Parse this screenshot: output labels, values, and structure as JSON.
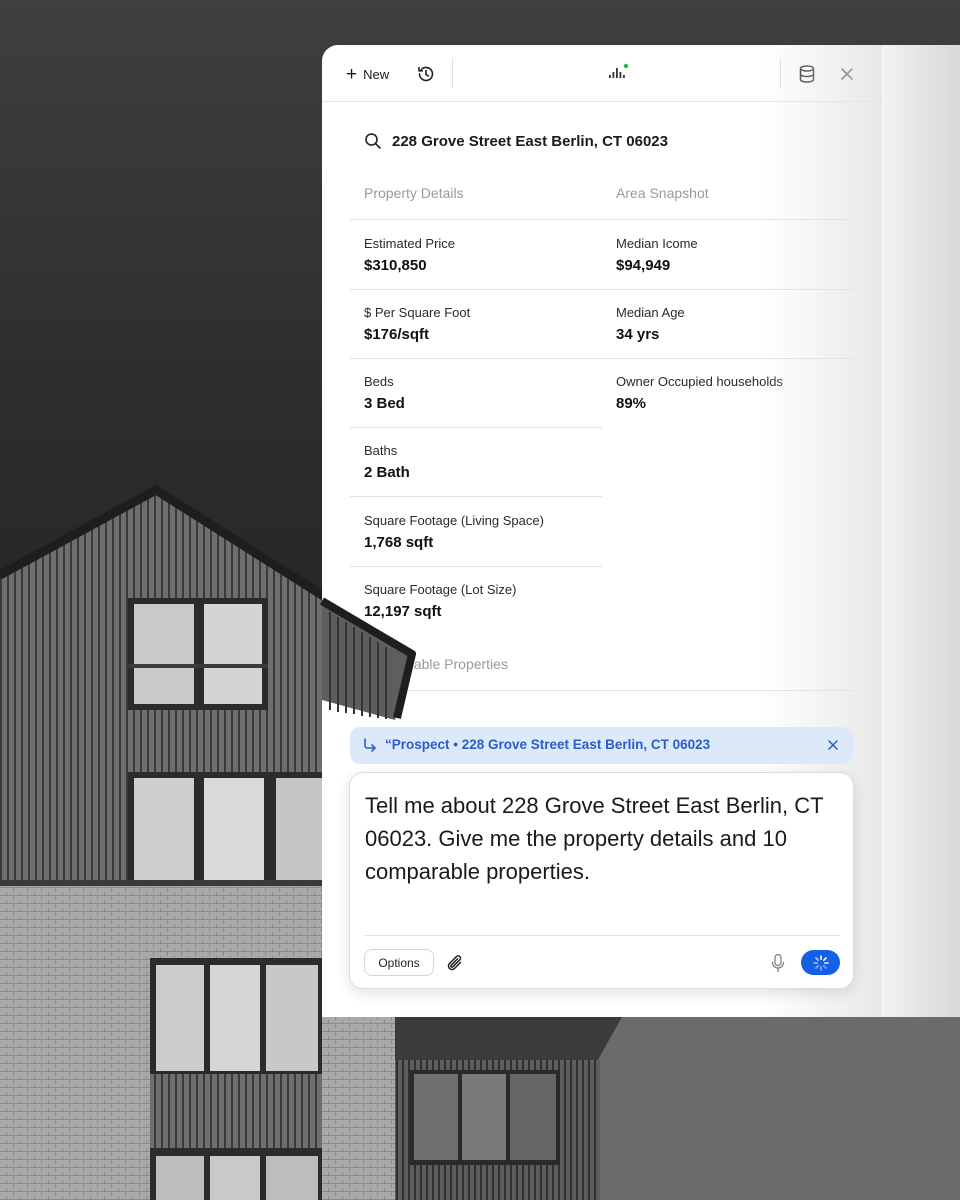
{
  "toolbar": {
    "new_label": "New",
    "new_icon": "plus-icon",
    "history_icon": "history-icon",
    "status_icon": "signal-icon",
    "database_icon": "database-icon",
    "close_icon": "close-icon",
    "status_dot_color": "#2bb24c"
  },
  "search": {
    "query": "228 Grove Street East Berlin, CT 06023"
  },
  "property_details": {
    "heading": "Property Details",
    "items": [
      {
        "label": "Estimated Price",
        "value": "$310,850"
      },
      {
        "label": "$ Per Square Foot",
        "value": "$176/sqft"
      },
      {
        "label": "Beds",
        "value": "3 Bed"
      },
      {
        "label": "Baths",
        "value": "2 Bath"
      },
      {
        "label": "Square Footage (Living Space)",
        "value": "1,768 sqft"
      },
      {
        "label": "Square Footage (Lot Size)",
        "value": "12,197 sqft"
      }
    ]
  },
  "area_snapshot": {
    "heading": "Area Snapshot",
    "items": [
      {
        "label": "Median Icome",
        "value": "$94,949"
      },
      {
        "label": "Median Age",
        "value": "34 yrs"
      },
      {
        "label": "Owner Occupied households",
        "value": "89%"
      }
    ]
  },
  "comparable": {
    "heading": "Comparable Properties"
  },
  "context_pill": {
    "text": "“Prospect • 228 Grove Street East Berlin, CT 06023",
    "accent": "#2a5ec9",
    "background": "#dce9fb"
  },
  "composer": {
    "message": "Tell me about 228 Grove Street East Berlin, CT 06023. Give me the property details and 10 comparable properties.",
    "options_label": "Options",
    "attach_icon": "paperclip-icon",
    "mic_icon": "microphone-icon",
    "send_icon": "loading-spinner-icon",
    "send_color": "#1660e6"
  }
}
